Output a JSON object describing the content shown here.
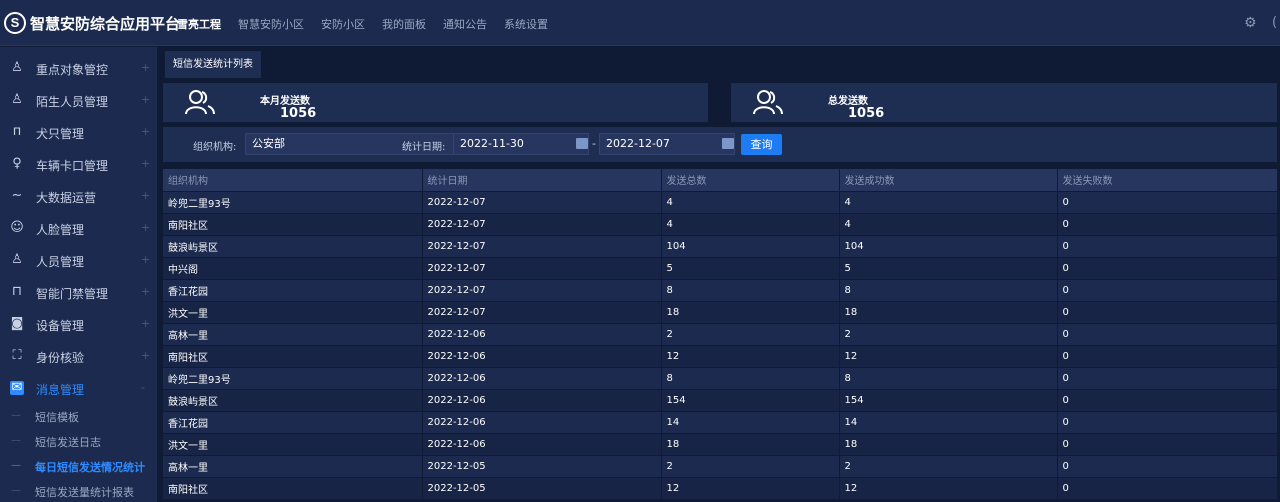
{
  "header": {
    "logo_text": "S",
    "app_title": "智慧安防综合应用平台",
    "nav": [
      "雪亮工程",
      "智慧安防小区",
      "安防小区",
      "我的面板",
      "通知公告",
      "系统设置"
    ],
    "active_nav": "雪亮工程"
  },
  "sidebar": {
    "items": [
      {
        "label": "重点对象管控",
        "icon": "person-icon"
      },
      {
        "label": "陌生人员管理",
        "icon": "person-icon"
      },
      {
        "label": "犬只管理",
        "icon": "dog-icon"
      },
      {
        "label": "车辆卡口管理",
        "icon": "barrier-icon"
      },
      {
        "label": "大数据运营",
        "icon": "trend-icon"
      },
      {
        "label": "人脸管理",
        "icon": "face-icon"
      },
      {
        "label": "人员管理",
        "icon": "person-icon"
      },
      {
        "label": "智能门禁管理",
        "icon": "lock-icon"
      },
      {
        "label": "设备管理",
        "icon": "camera-icon"
      },
      {
        "label": "身份核验",
        "icon": "scan-icon"
      },
      {
        "label": "消息管理",
        "icon": "message-icon"
      }
    ],
    "sub_items": [
      "短信模板",
      "短信发送日志",
      "每日短信发送情况统计",
      "短信发送量统计报表"
    ],
    "active_sub": "每日短信发送情况统计"
  },
  "tab": {
    "label": "短信发送统计列表"
  },
  "cards": [
    {
      "title": "本月发送数",
      "value": "1056"
    },
    {
      "title": "总发送数",
      "value": "1056"
    }
  ],
  "filter": {
    "org_label": "组织机构:",
    "org_value": "公安部",
    "date_label": "统计日期:",
    "date_start": "2022-11-30",
    "date_sep": "-",
    "date_end": "2022-12-07",
    "query_label": "查询"
  },
  "table": {
    "columns": [
      "组织机构",
      "统计日期",
      "发送总数",
      "发送成功数",
      "发送失败数"
    ],
    "rows": [
      [
        "岭兜二里93号",
        "2022-12-07",
        "4",
        "4",
        "0"
      ],
      [
        "南阳社区",
        "2022-12-07",
        "4",
        "4",
        "0"
      ],
      [
        "鼓浪屿景区",
        "2022-12-07",
        "104",
        "104",
        "0"
      ],
      [
        "中兴阁",
        "2022-12-07",
        "5",
        "5",
        "0"
      ],
      [
        "香江花园",
        "2022-12-07",
        "8",
        "8",
        "0"
      ],
      [
        "洪文一里",
        "2022-12-07",
        "18",
        "18",
        "0"
      ],
      [
        "高林一里",
        "2022-12-06",
        "2",
        "2",
        "0"
      ],
      [
        "南阳社区",
        "2022-12-06",
        "12",
        "12",
        "0"
      ],
      [
        "岭兜二里93号",
        "2022-12-06",
        "8",
        "8",
        "0"
      ],
      [
        "鼓浪屿景区",
        "2022-12-06",
        "154",
        "154",
        "0"
      ],
      [
        "香江花园",
        "2022-12-06",
        "14",
        "14",
        "0"
      ],
      [
        "洪文一里",
        "2022-12-06",
        "18",
        "18",
        "0"
      ],
      [
        "高林一里",
        "2022-12-05",
        "2",
        "2",
        "0"
      ],
      [
        "南阳社区",
        "2022-12-05",
        "12",
        "12",
        "0"
      ]
    ]
  }
}
